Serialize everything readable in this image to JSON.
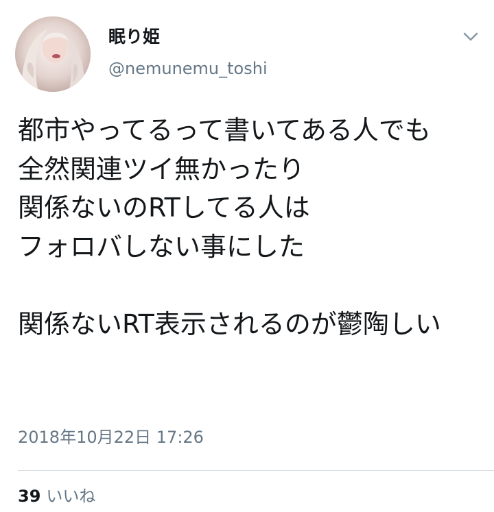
{
  "tweet": {
    "author": {
      "display_name": "眠り姫",
      "handle": "@nemunemu_toshi"
    },
    "text": "都市やってるって書いてある人でも\n全然関連ツイ無かったり\n関係ないのRTしてる人は\nフォロバしない事にした\n\n関係ないRT表示されるのが鬱陶しい",
    "timestamp": "2018年10月22日 17:26",
    "likes": {
      "count": "39",
      "label": "いいね"
    }
  },
  "icons": {
    "menu": "chevron-down-icon"
  },
  "colors": {
    "text_primary": "#14171a",
    "text_secondary": "#657786",
    "divider": "#d8dee3",
    "background": "#ffffff"
  }
}
